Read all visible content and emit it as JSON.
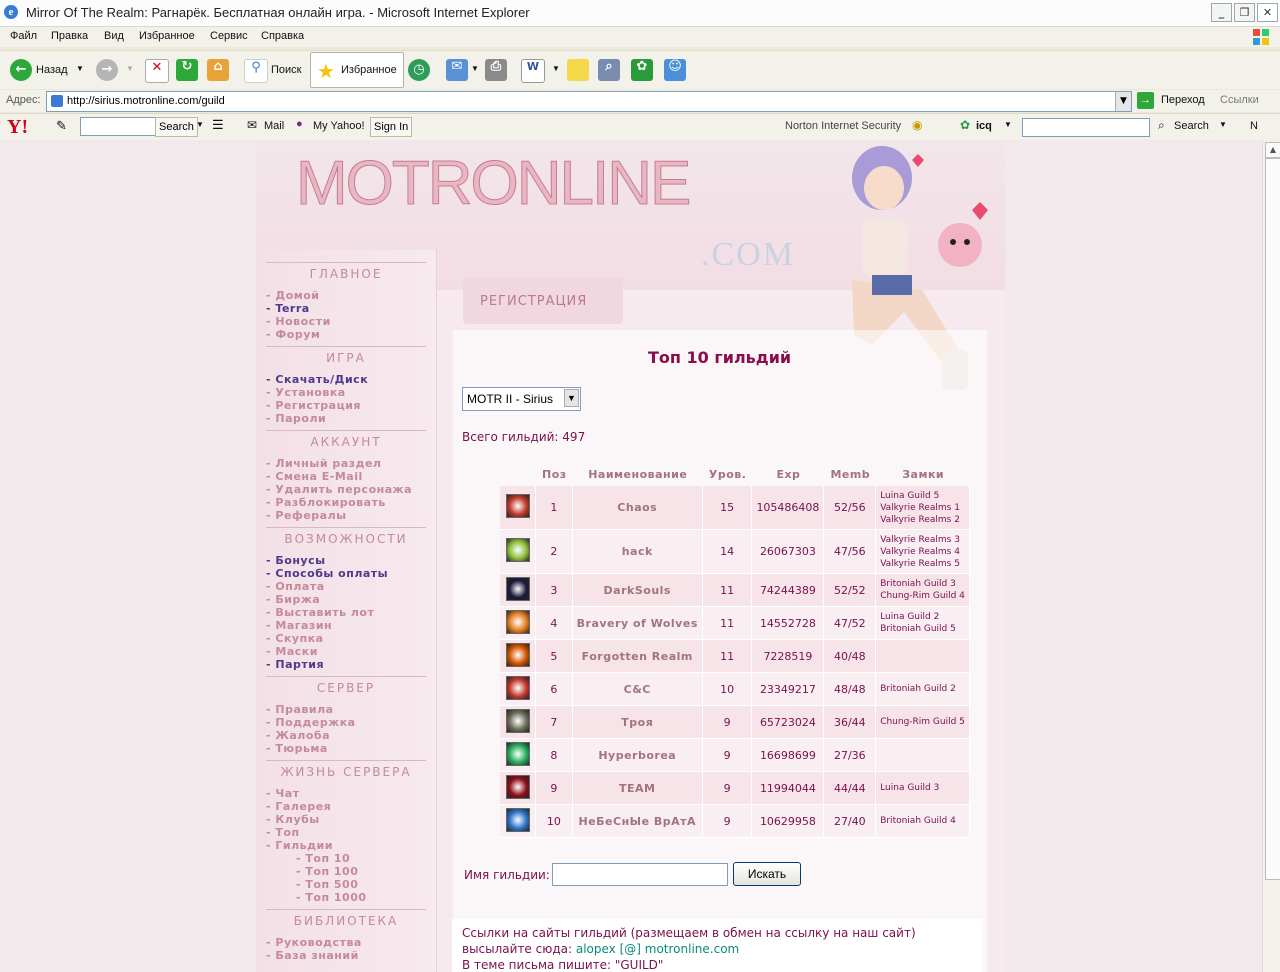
{
  "window": {
    "title": "Mirror Of The Realm: Рагнарёк. Бесплатная онлайн игра. - Microsoft Internet Explorer",
    "controls": [
      "_",
      "❐",
      "✕"
    ]
  },
  "menu": [
    "Файл",
    "Правка",
    "Вид",
    "Избранное",
    "Сервис",
    "Справка"
  ],
  "toolbar": {
    "back": "Назад",
    "search": "Поиск",
    "favorites": "Избранное"
  },
  "address": {
    "label": "Адрес:",
    "url": "http://sirius.motronline.com/guild",
    "go": "Переход",
    "links": "Ссылки"
  },
  "yahoo_bar": {
    "logo": "Y!",
    "search_btn": "Search",
    "mail": "Mail",
    "my_yahoo": "My Yahoo!",
    "sign_in": "Sign In",
    "norton": "Norton Internet Security",
    "icq": "icq",
    "search2": "Search",
    "n": "N"
  },
  "site": {
    "logo": "MOTRONLINE",
    "logo_suffix": ".COM",
    "register_tab": "РЕГИСТРАЦИЯ"
  },
  "sidebar": {
    "sections": [
      {
        "title": "ГЛАВНОЕ",
        "items": [
          "- Домой",
          "- Terra",
          "- Новости",
          "- Форум"
        ]
      },
      {
        "title": "ИГРА",
        "items": [
          "- Скачать/Диск",
          "- Установка",
          "- Регистрация",
          "- Пароли"
        ]
      },
      {
        "title": "АККАУНТ",
        "items": [
          "- Личный раздел",
          "- Смена E-Mail",
          "- Удалить персонажа",
          "- Разблокировать",
          "- Рефералы"
        ]
      },
      {
        "title": "ВОЗМОЖНОСТИ",
        "items": [
          "- Бонусы",
          "- Способы оплаты",
          "- Оплата",
          "- Биржа",
          "- Выставить лот",
          "- Магазин",
          "- Скупка",
          "- Маски",
          "- Партия"
        ]
      },
      {
        "title": "СЕРВЕР",
        "items": [
          "- Правила",
          "- Поддержка",
          "- Жалоба",
          "- Тюрьма"
        ]
      },
      {
        "title": "ЖИЗНЬ СЕРВЕРА",
        "items": [
          "- Чат",
          "- Галерея",
          "- Клубы",
          "- Топ",
          "- Гильдии",
          "- Топ 10",
          "- Топ 100",
          "- Топ 500",
          "- Топ 1000"
        ]
      },
      {
        "title": "БИБЛИОТЕКА",
        "items": [
          "- Руководства",
          "- База знаний"
        ]
      }
    ]
  },
  "guild_page": {
    "heading": "Топ 10 гильдий",
    "server_select": "MOTR II - Sirius",
    "total_label": "Всего гильдий:",
    "total_value": "497",
    "columns": [
      "Поз",
      "Наименование",
      "Уров.",
      "Exp",
      "Memb",
      "Замки"
    ],
    "rows": [
      {
        "pos": "1",
        "name": "Chaos",
        "level": "15",
        "exp": "105486408",
        "memb": "52/56",
        "castles": [
          "Luina Guild 5",
          "Valkyrie Realms 1",
          "Valkyrie Realms 2"
        ],
        "icon": "sword-icon",
        "color": "#c0392b"
      },
      {
        "pos": "2",
        "name": "hack",
        "level": "14",
        "exp": "26067303",
        "memb": "47/56",
        "castles": [
          "Valkyrie Realms 3",
          "Valkyrie Realms 4",
          "Valkyrie Realms 5"
        ],
        "icon": "hack-emblem-icon",
        "color": "#8bbf3a"
      },
      {
        "pos": "3",
        "name": "DarkSouls",
        "level": "11",
        "exp": "74244389",
        "memb": "52/52",
        "castles": [
          "Britoniah Guild 3",
          "Chung-Rim Guild 4"
        ],
        "icon": "dark-orb-icon",
        "color": "#1a1a3a"
      },
      {
        "pos": "4",
        "name": "Bravery of Wolves",
        "level": "11",
        "exp": "14552728",
        "memb": "47/52",
        "castles": [
          "Luina Guild 2",
          "Britoniah Guild 5"
        ],
        "icon": "wolf-paw-icon",
        "color": "#e67e22"
      },
      {
        "pos": "5",
        "name": "Forgotten Realm",
        "level": "11",
        "exp": "7228519",
        "memb": "40/48",
        "castles": [],
        "icon": "fire-orb-icon",
        "color": "#d35400"
      },
      {
        "pos": "6",
        "name": "C&C",
        "level": "10",
        "exp": "23349217",
        "memb": "48/48",
        "castles": [
          "Britoniah Guild 2"
        ],
        "icon": "fire-orb-icon",
        "color": "#c0392b"
      },
      {
        "pos": "7",
        "name": "Троя",
        "level": "9",
        "exp": "65723024",
        "memb": "36/44",
        "castles": [
          "Chung-Rim Guild 5"
        ],
        "icon": "warrior-icon",
        "color": "#6d6d5a"
      },
      {
        "pos": "8",
        "name": "Hyperborea",
        "level": "9",
        "exp": "16698699",
        "memb": "27/36",
        "castles": [],
        "icon": "leaf-icon",
        "color": "#27ae60"
      },
      {
        "pos": "9",
        "name": "TEAM",
        "level": "9",
        "exp": "11994044",
        "memb": "44/44",
        "castles": [
          "Luina Guild 3"
        ],
        "icon": "red-star-icon",
        "color": "#8e0d1a"
      },
      {
        "pos": "10",
        "name": "НеБеСнЫе ВрАтА",
        "level": "9",
        "exp": "10629958",
        "memb": "27/40",
        "castles": [
          "Britoniah Guild 4"
        ],
        "icon": "blue-burst-icon",
        "color": "#2d73c9"
      }
    ],
    "search_label": "Имя гильдии:",
    "search_button": "Искать",
    "info_line1": "Ссылки на сайты гильдий (размещаем в обмен на ссылку на наш сайт)",
    "info_line2a": "высылайте сюда:",
    "info_line2b": "alopex [@] motronline.com",
    "info_line3": "В теме письма пишите: \"GUILD\""
  }
}
